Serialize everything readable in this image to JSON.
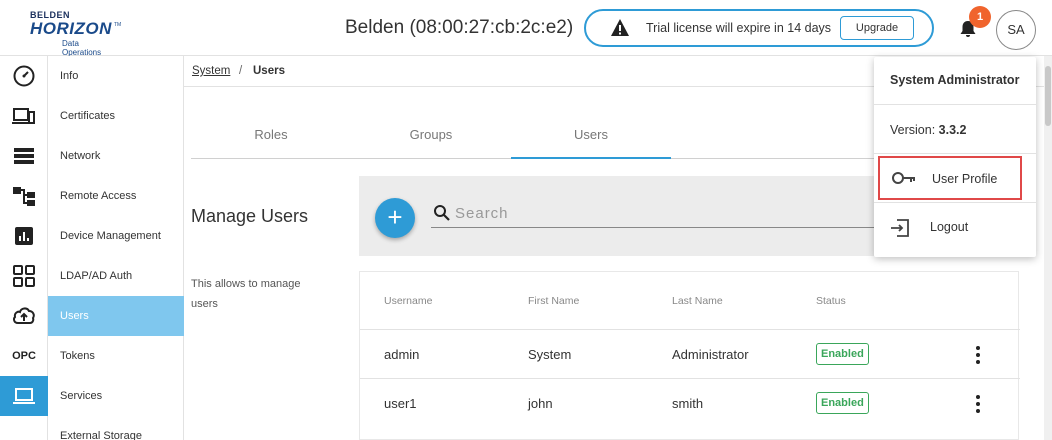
{
  "header": {
    "logo_top": "BELDEN",
    "logo_main": "HORIZON",
    "logo_tm": "TM",
    "logo_sub": "Data Operations",
    "device_title": "Belden (08:00:27:cb:2c:e2)",
    "trial_text": "Trial license will expire in 14 days",
    "upgrade_label": "Upgrade",
    "notification_count": "1",
    "avatar_initials": "SA"
  },
  "rail": {
    "icons": [
      "dashboard-icon",
      "devices-icon",
      "storage-icon",
      "hierarchy-icon",
      "analytics-icon",
      "apps-grid-icon",
      "cloud-upload-icon",
      "opc-label",
      "laptop-icon"
    ],
    "opc_label": "OPC",
    "active_index": 8
  },
  "nav": {
    "items": [
      {
        "label": "Info"
      },
      {
        "label": "Certificates"
      },
      {
        "label": "Network"
      },
      {
        "label": "Remote Access"
      },
      {
        "label": "Device Management"
      },
      {
        "label": "LDAP/AD Auth"
      },
      {
        "label": "Users",
        "active": true
      },
      {
        "label": "Tokens"
      },
      {
        "label": "Services"
      },
      {
        "label": "External Storage"
      }
    ]
  },
  "breadcrumb": {
    "parent": "System",
    "separator": "/",
    "current": "Users"
  },
  "tabs": [
    {
      "label": "Roles"
    },
    {
      "label": "Groups"
    },
    {
      "label": "Users",
      "active": true
    }
  ],
  "manage": {
    "title": "Manage Users",
    "description": "This allows to manage users"
  },
  "search": {
    "add_label": "+",
    "placeholder": "Search",
    "value": ""
  },
  "table": {
    "columns": [
      "Username",
      "First Name",
      "Last Name",
      "Status"
    ],
    "rows": [
      {
        "username": "admin",
        "first_name": "System",
        "last_name": "Administrator",
        "status": "Enabled"
      },
      {
        "username": "user1",
        "first_name": "john",
        "last_name": "smith",
        "status": "Enabled"
      }
    ]
  },
  "user_menu": {
    "name": "System Administrator",
    "version_label": "Version:",
    "version_value": "3.3.2",
    "items": [
      {
        "label": "User Profile",
        "icon": "key-icon",
        "highlighted": true
      },
      {
        "label": "Logout",
        "icon": "logout-icon"
      }
    ]
  },
  "colors": {
    "accent": "#2e9bd6",
    "nav_active": "#7fc7ee",
    "badge": "#f0642d",
    "status_enabled": "#3aa65a",
    "highlight": "#e04848"
  }
}
